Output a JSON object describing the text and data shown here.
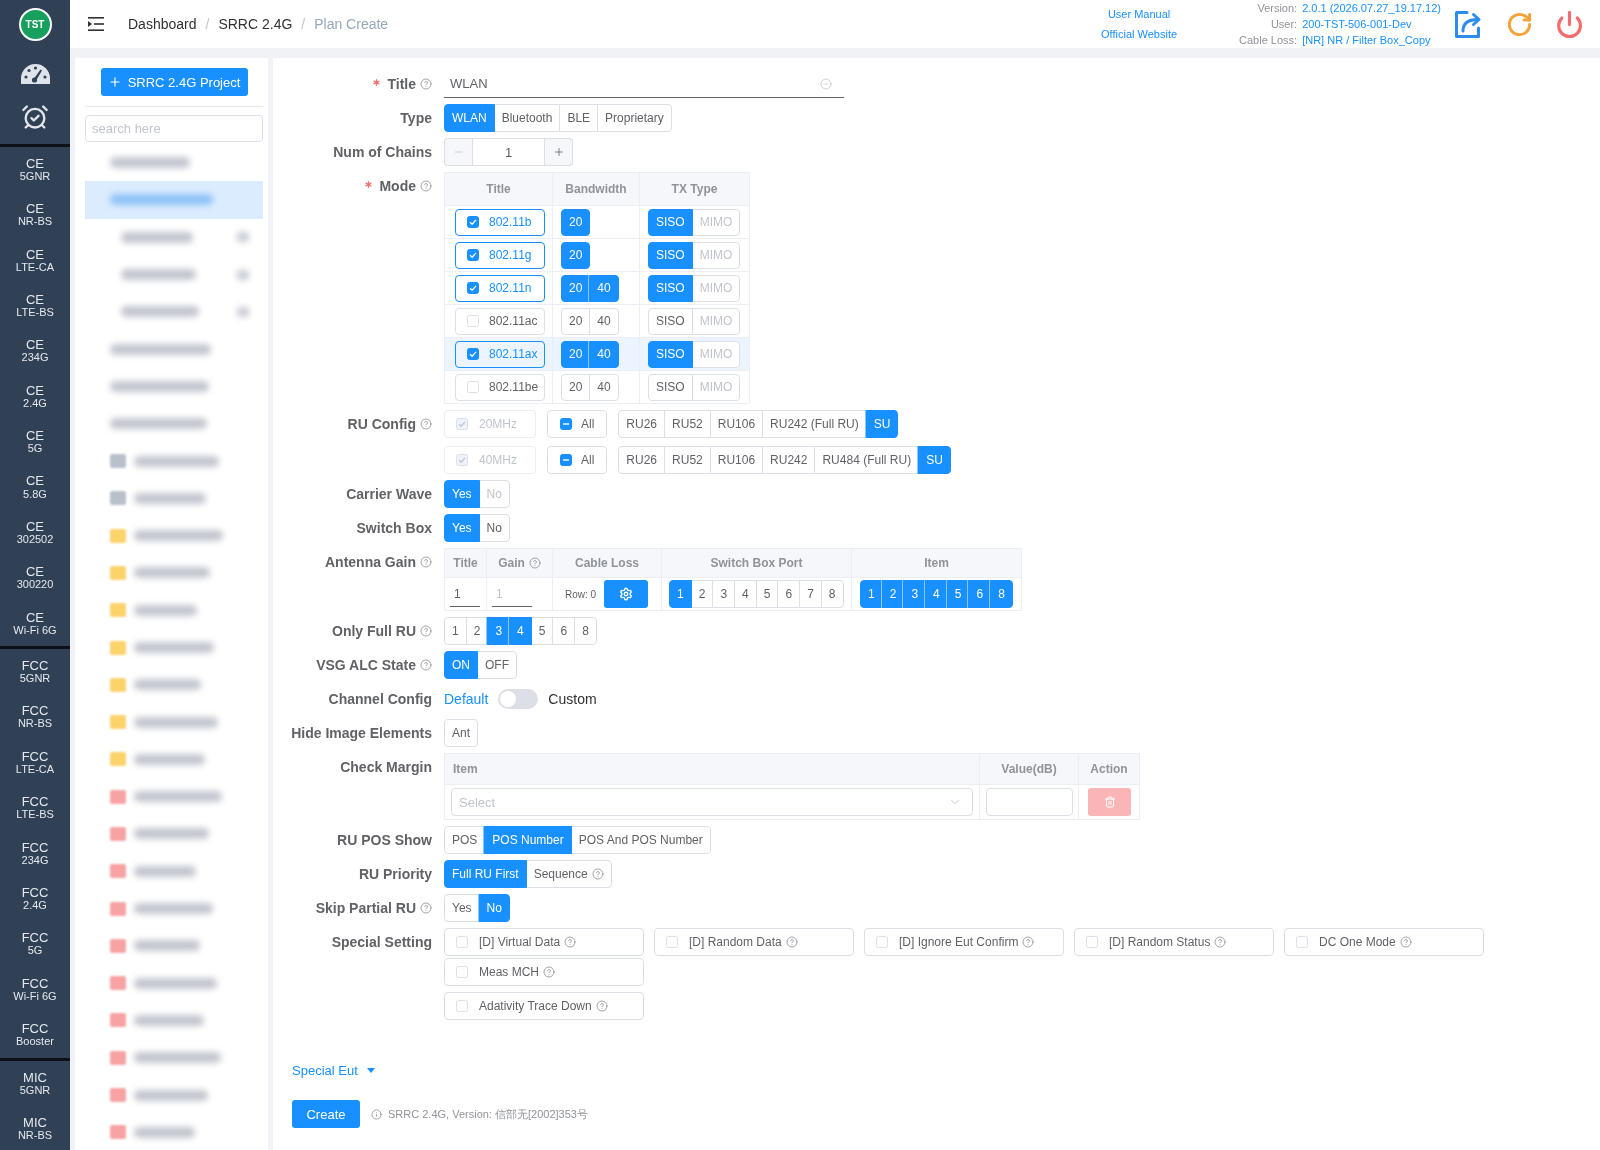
{
  "sidebar": {
    "logo": "TST",
    "nav_groups": [
      {
        "items": [
          {
            "title": "CE",
            "subtitle": "5GNR"
          },
          {
            "title": "CE",
            "subtitle": "NR-BS"
          },
          {
            "title": "CE",
            "subtitle": "LTE-CA"
          },
          {
            "title": "CE",
            "subtitle": "LTE-BS"
          },
          {
            "title": "CE",
            "subtitle": "234G"
          },
          {
            "title": "CE",
            "subtitle": "2.4G"
          },
          {
            "title": "CE",
            "subtitle": "5G"
          },
          {
            "title": "CE",
            "subtitle": "5.8G"
          },
          {
            "title": "CE",
            "subtitle": "302502"
          },
          {
            "title": "CE",
            "subtitle": "300220"
          },
          {
            "title": "CE",
            "subtitle": "Wi-Fi 6G"
          }
        ]
      },
      {
        "items": [
          {
            "title": "FCC",
            "subtitle": "5GNR"
          },
          {
            "title": "FCC",
            "subtitle": "NR-BS"
          },
          {
            "title": "FCC",
            "subtitle": "LTE-CA"
          },
          {
            "title": "FCC",
            "subtitle": "LTE-BS"
          },
          {
            "title": "FCC",
            "subtitle": "234G"
          },
          {
            "title": "FCC",
            "subtitle": "2.4G"
          },
          {
            "title": "FCC",
            "subtitle": "5G"
          },
          {
            "title": "FCC",
            "subtitle": "Wi-Fi 6G"
          },
          {
            "title": "FCC",
            "subtitle": "Booster"
          }
        ]
      },
      {
        "items": [
          {
            "title": "MIC",
            "subtitle": "5GNR"
          },
          {
            "title": "MIC",
            "subtitle": "NR-BS"
          }
        ]
      }
    ]
  },
  "header": {
    "breadcrumb": {
      "separator": "/",
      "items": [
        {
          "label": "Dashboard",
          "current": false
        },
        {
          "label": "SRRC 2.4G",
          "current": false
        },
        {
          "label": "Plan Create",
          "current": true
        }
      ]
    },
    "links": [
      "User Manual",
      "Official Website"
    ],
    "info": [
      {
        "label": "Version:",
        "value": "2.0.1 (2026.07.27_19.17.12)"
      },
      {
        "label": "User:",
        "value": "200-TST-506-001-Dev"
      },
      {
        "label": "Cable Loss:",
        "value": "[NR] NR / Filter Box_Copy"
      }
    ]
  },
  "tree_panel": {
    "add_button": "SRRC 2.4G Project",
    "search": {
      "placeholder": "search here"
    },
    "items": [
      {
        "selected": false
      },
      {
        "selected": true,
        "children": [
          {
            "selected": false
          },
          {
            "selected": false
          },
          {
            "selected": false
          }
        ]
      },
      {
        "selected": false
      },
      {
        "selected": false
      },
      {
        "selected": false
      },
      {
        "selected": false,
        "color": "#b9c0cc"
      },
      {
        "selected": false,
        "color": "#b9c0cc"
      },
      {
        "selected": false,
        "color": "#fbd36b"
      },
      {
        "selected": false,
        "color": "#fbd36b"
      },
      {
        "selected": false,
        "color": "#fbd36b"
      },
      {
        "selected": false,
        "color": "#fbd36b"
      },
      {
        "selected": false,
        "color": "#fbd36b"
      },
      {
        "selected": false,
        "color": "#fbd36b"
      },
      {
        "selected": false,
        "color": "#fbd36b"
      },
      {
        "selected": false,
        "color": "#f8a3a3"
      },
      {
        "selected": false,
        "color": "#f8a3a3"
      },
      {
        "selected": false,
        "color": "#f8a3a3"
      },
      {
        "selected": false,
        "color": "#f8a3a3"
      },
      {
        "selected": false,
        "color": "#f8a3a3"
      },
      {
        "selected": false,
        "color": "#f8a3a3"
      },
      {
        "selected": false,
        "color": "#f8a3a3"
      },
      {
        "selected": false,
        "color": "#f8a3a3"
      },
      {
        "selected": false,
        "color": "#f8a3a3"
      },
      {
        "selected": false,
        "color": "#f8a3a3"
      }
    ]
  },
  "form": {
    "fields": [
      {
        "kind": "input",
        "label": "Title",
        "required": true,
        "help": true,
        "value": "WLAN",
        "valid": true
      },
      {
        "kind": "button_group",
        "label": "Type",
        "options": [
          {
            "label": "WLAN",
            "selected": true
          },
          {
            "label": "Bluetooth",
            "selected": false
          },
          {
            "label": "BLE",
            "selected": false
          },
          {
            "label": "Proprietary",
            "selected": false
          }
        ]
      },
      {
        "kind": "stepper",
        "label": "Num of Chains",
        "value": "1",
        "decrease_disabled": true
      },
      {
        "kind": "mode_table",
        "label": "Mode",
        "required": true,
        "help": true,
        "columns": [
          "Title",
          "Bandwidth",
          "TX Type"
        ],
        "rows": [
          {
            "title": "802.11b",
            "checked": true,
            "highlighted": false,
            "bandwidth": [
              {
                "label": "20",
                "selected": true
              }
            ],
            "tx": [
              {
                "label": "SISO",
                "selected": true,
                "disabled": false
              },
              {
                "label": "MIMO",
                "selected": false,
                "disabled": true
              }
            ]
          },
          {
            "title": "802.11g",
            "checked": true,
            "highlighted": false,
            "bandwidth": [
              {
                "label": "20",
                "selected": true
              }
            ],
            "tx": [
              {
                "label": "SISO",
                "selected": true,
                "disabled": false
              },
              {
                "label": "MIMO",
                "selected": false,
                "disabled": true
              }
            ]
          },
          {
            "title": "802.11n",
            "checked": true,
            "highlighted": false,
            "bandwidth": [
              {
                "label": "20",
                "selected": true
              },
              {
                "label": "40",
                "selected": true
              }
            ],
            "tx": [
              {
                "label": "SISO",
                "selected": true,
                "disabled": false
              },
              {
                "label": "MIMO",
                "selected": false,
                "disabled": true
              }
            ]
          },
          {
            "title": "802.11ac",
            "checked": false,
            "highlighted": false,
            "bandwidth": [
              {
                "label": "20",
                "selected": false
              },
              {
                "label": "40",
                "selected": false
              }
            ],
            "tx": [
              {
                "label": "SISO",
                "selected": false,
                "disabled": false
              },
              {
                "label": "MIMO",
                "selected": false,
                "disabled": true
              }
            ]
          },
          {
            "title": "802.11ax",
            "checked": true,
            "highlighted": true,
            "bandwidth": [
              {
                "label": "20",
                "selected": true
              },
              {
                "label": "40",
                "selected": true
              }
            ],
            "tx": [
              {
                "label": "SISO",
                "selected": true,
                "disabled": false
              },
              {
                "label": "MIMO",
                "selected": false,
                "disabled": true
              }
            ]
          },
          {
            "title": "802.11be",
            "checked": false,
            "highlighted": false,
            "bandwidth": [
              {
                "label": "20",
                "selected": false
              },
              {
                "label": "40",
                "selected": false
              }
            ],
            "tx": [
              {
                "label": "SISO",
                "selected": false,
                "disabled": false
              },
              {
                "label": "MIMO",
                "selected": false,
                "disabled": true
              }
            ]
          }
        ]
      },
      {
        "kind": "ru_config",
        "label": "RU Config",
        "help": true,
        "rows": [
          {
            "band": {
              "label": "20MHz",
              "checked": true,
              "disabled": true
            },
            "all": {
              "label": "All",
              "indeterminate": true
            },
            "options": [
              {
                "label": "RU26",
                "selected": false
              },
              {
                "label": "RU52",
                "selected": false
              },
              {
                "label": "RU106",
                "selected": false
              },
              {
                "label": "RU242 (Full RU)",
                "selected": false
              },
              {
                "label": "SU",
                "selected": true
              }
            ]
          },
          {
            "band": {
              "label": "40MHz",
              "checked": true,
              "disabled": true
            },
            "all": {
              "label": "All",
              "indeterminate": true
            },
            "options": [
              {
                "label": "RU26",
                "selected": false
              },
              {
                "label": "RU52",
                "selected": false
              },
              {
                "label": "RU106",
                "selected": false
              },
              {
                "label": "RU242",
                "selected": false
              },
              {
                "label": "RU484 (Full RU)",
                "selected": false
              },
              {
                "label": "SU",
                "selected": true
              }
            ]
          }
        ]
      },
      {
        "kind": "button_group",
        "label": "Carrier Wave",
        "options": [
          {
            "label": "Yes",
            "selected": true,
            "disabled": false
          },
          {
            "label": "No",
            "selected": false,
            "disabled": true
          }
        ]
      },
      {
        "kind": "button_group",
        "label": "Switch Box",
        "options": [
          {
            "label": "Yes",
            "selected": true
          },
          {
            "label": "No",
            "selected": false
          }
        ]
      },
      {
        "kind": "antenna_table",
        "label": "Antenna Gain",
        "help": true,
        "columns": [
          {
            "label": "Title"
          },
          {
            "label": "Gain",
            "help": true
          },
          {
            "label": "Cable Loss"
          },
          {
            "label": "Switch Box Port"
          },
          {
            "label": "Item"
          }
        ],
        "row": {
          "title": {
            "value": "1"
          },
          "gain": {
            "placeholder": "1"
          },
          "cable_loss": "Row: 0",
          "switch_box_port": [
            {
              "label": "1",
              "selected": true
            },
            {
              "label": "2",
              "selected": false
            },
            {
              "label": "3",
              "selected": false
            },
            {
              "label": "4",
              "selected": false
            },
            {
              "label": "5",
              "selected": false
            },
            {
              "label": "6",
              "selected": false
            },
            {
              "label": "7",
              "selected": false
            },
            {
              "label": "8",
              "selected": false
            }
          ],
          "item": [
            {
              "label": "1",
              "selected": true
            },
            {
              "label": "2",
              "selected": true
            },
            {
              "label": "3",
              "selected": true
            },
            {
              "label": "4",
              "selected": true
            },
            {
              "label": "5",
              "selected": true
            },
            {
              "label": "6",
              "selected": true
            },
            {
              "label": "8",
              "selected": true
            }
          ]
        }
      },
      {
        "kind": "button_group",
        "label": "Only Full RU",
        "help": true,
        "options": [
          {
            "label": "1",
            "selected": false
          },
          {
            "label": "2",
            "selected": false
          },
          {
            "label": "3",
            "selected": true
          },
          {
            "label": "4",
            "selected": true
          },
          {
            "label": "5",
            "selected": false
          },
          {
            "label": "6",
            "selected": false
          },
          {
            "label": "8",
            "selected": false
          }
        ]
      },
      {
        "kind": "button_group",
        "label": "VSG ALC State",
        "help": true,
        "options": [
          {
            "label": "ON",
            "selected": true
          },
          {
            "label": "OFF",
            "selected": false
          }
        ]
      },
      {
        "kind": "switch",
        "label": "Channel Config",
        "off_label": "Default",
        "on_label": "Custom",
        "on": false
      },
      {
        "kind": "button_group",
        "label": "Hide Image Elements",
        "options": [
          {
            "label": "Ant",
            "selected": false
          }
        ]
      },
      {
        "kind": "check_margin",
        "label": "Check Margin",
        "columns": [
          "Item",
          "Value(dB)",
          "Action"
        ],
        "row": {
          "item": {
            "placeholder": "Select"
          },
          "delete_disabled": true
        }
      },
      {
        "kind": "button_group",
        "label": "RU POS Show",
        "options": [
          {
            "label": "POS",
            "selected": false
          },
          {
            "label": "POS Number",
            "selected": true
          },
          {
            "label": "POS And POS Number",
            "selected": false
          }
        ]
      },
      {
        "kind": "button_group",
        "label": "RU Priority",
        "options": [
          {
            "label": "Full RU First",
            "selected": true
          },
          {
            "label": "Sequence",
            "selected": false,
            "help": true
          }
        ]
      },
      {
        "kind": "button_group",
        "label": "Skip Partial RU",
        "help": true,
        "options": [
          {
            "label": "Yes",
            "selected": false
          },
          {
            "label": "No",
            "selected": true
          }
        ]
      },
      {
        "kind": "checkbox_grid",
        "label": "Special Setting",
        "groups": [
          {
            "options": [
              {
                "label": "[D] Virtual Data",
                "checked": false,
                "help": true
              },
              {
                "label": "[D] Random Data",
                "checked": false,
                "help": true
              },
              {
                "label": "[D] Ignore Eut Confirm",
                "checked": false,
                "help": true
              },
              {
                "label": "[D] Random Status",
                "checked": false,
                "help": true
              },
              {
                "label": "DC One Mode",
                "checked": false,
                "help": true
              },
              {
                "label": "Meas MCH",
                "checked": false,
                "help": true
              }
            ]
          },
          {
            "options": [
              {
                "label": "Adativity Trace Down",
                "checked": false,
                "help": true
              }
            ]
          }
        ]
      }
    ],
    "special_eut": "Special Eut",
    "submit": "Create",
    "note": "SRRC 2.4G, Version: 信部无[2002]353号"
  }
}
